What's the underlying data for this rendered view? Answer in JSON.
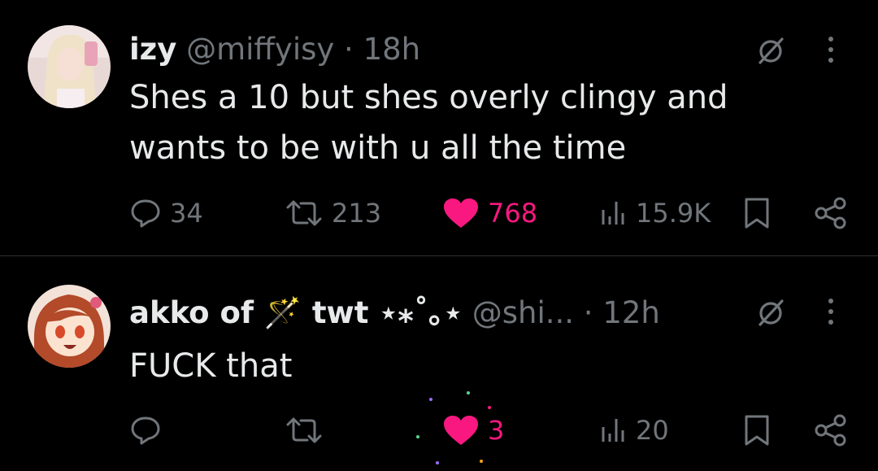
{
  "posts": [
    {
      "name": "izy",
      "handle": "@miffyisy",
      "separator": "·",
      "time": "18h",
      "text": "Shes a 10 but shes overly clingy and\nwants to be with u all the time",
      "replies": "34",
      "reposts": "213",
      "likes": "768",
      "views": "15.9K",
      "liked": true
    },
    {
      "name": "akko of 🪄 twt ⋆⁎˚｡⋆",
      "handle": "@shi...",
      "separator": "·",
      "time": "12h",
      "text": "FUCK that",
      "replies": "",
      "reposts": "",
      "likes": "3",
      "views": "20",
      "liked": true
    }
  ],
  "colors": {
    "background": "#000000",
    "text": "#e7e9ea",
    "muted": "#71767b",
    "like": "#f91880",
    "divider": "#2f3336"
  },
  "icons": [
    "grok-icon",
    "more-icon",
    "reply-icon",
    "repost-icon",
    "heart-icon",
    "views-icon",
    "bookmark-icon",
    "share-icon"
  ]
}
